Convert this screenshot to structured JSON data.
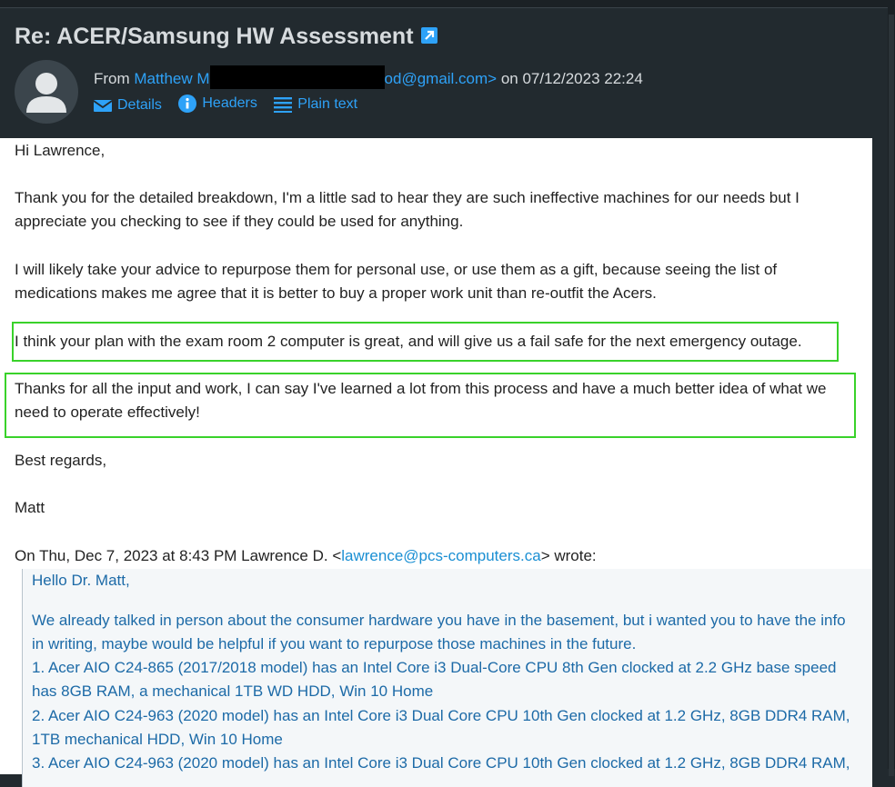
{
  "header": {
    "subject": "Re: ACER/Samsung HW Assessment",
    "from_prefix": "From ",
    "sender_name_visible": "Matthew M",
    "sender_email_visible": "od@gmail.com>",
    "date_prefix": " on ",
    "date": "07/12/2023 22:24",
    "actions": [
      {
        "label": "Details",
        "icon": "envelope-icon"
      },
      {
        "label": "Headers",
        "icon": "info-icon"
      },
      {
        "label": "Plain text",
        "icon": "lines-icon"
      }
    ]
  },
  "body": {
    "greeting": "Hi Lawrence,",
    "p1_line1": "Thank you for the detailed breakdown, I'm a little sad to hear they are such ineffective machines for our needs but I",
    "p1_line2": "appreciate you checking to see if they could be used for anything.",
    "p2_line1": "I will likely take your advice to repurpose them for personal use, or use them as a gift, because seeing the list of",
    "p2_line2": "medications makes me agree that it is better to buy a proper work unit than re-outfit the Acers.",
    "p3": "I think your plan with the exam room 2 computer is great, and will give us a fail safe for the next emergency outage.",
    "p4_line1": "Thanks for all the input and work, I can say I've learned a lot from this process and have a much better idea of what we",
    "p4_line2": "need to operate effectively!",
    "signoff": "Best regards,",
    "signature": "Matt",
    "quote_intro_prefix": "On Thu, Dec 7, 2023 at 8:43 PM Lawrence D. <",
    "quote_intro_email": "lawrence@pcs-computers.ca",
    "quote_intro_suffix": "> wrote:"
  },
  "quote": {
    "greeting": "Hello Dr. Matt,",
    "l1": "We already talked in person about the consumer hardware you have in the basement, but i wanted you to have the info",
    "l2": "in writing, maybe would be helpful if you want to repurpose those machines in the future.",
    "l3": "1. Acer AIO C24-865 (2017/2018 model) has an Intel Core i3 Dual-Core CPU 8th Gen clocked at 2.2 GHz base speed",
    "l4": "has 8GB RAM, a mechanical 1TB WD HDD, Win 10 Home",
    "l5": "2. Acer AIO C24-963 (2020 model) has an Intel Core i3 Dual Core CPU 10th Gen clocked at 1.2 GHz, 8GB DDR4 RAM,",
    "l6": "1TB mechanical HDD, Win 10 Home",
    "l7": "3. Acer AIO C24-963 (2020 model) has an Intel Core i3 Dual Core CPU 10th Gen clocked at 1.2 GHz, 8GB DDR4 RAM,"
  },
  "colors": {
    "background": "#222a2f",
    "link": "#2ea2f8",
    "highlight": "#39d22a",
    "quote_text": "#1c6aa7"
  }
}
